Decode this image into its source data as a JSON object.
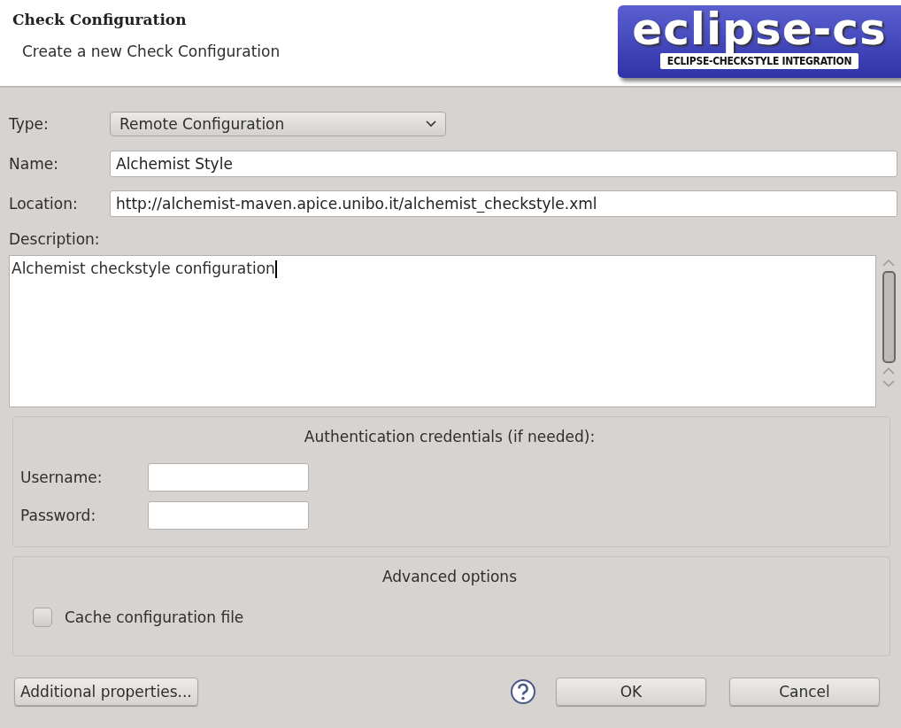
{
  "header": {
    "title": "Check Configuration",
    "subtitle": "Create a new Check Configuration",
    "logo": {
      "title": "eclipse-cs",
      "subtitle": "ECLIPSE-CHECKSTYLE INTEGRATION"
    }
  },
  "form": {
    "type": {
      "label": "Type:",
      "value": "Remote Configuration"
    },
    "name": {
      "label": "Name:",
      "value": "Alchemist Style"
    },
    "location": {
      "label": "Location:",
      "value": "http://alchemist-maven.apice.unibo.it/alchemist_checkstyle.xml"
    },
    "description": {
      "label": "Description:",
      "value": "Alchemist checkstyle configuration"
    }
  },
  "authentication": {
    "title": "Authentication credentials (if needed):",
    "username": {
      "label": "Username:"
    },
    "password": {
      "label": "Password:"
    }
  },
  "advanced": {
    "title": "Advanced options",
    "cache": {
      "label": "Cache configuration file",
      "checked": false
    }
  },
  "buttons": {
    "additional": "Additional properties...",
    "ok": "OK",
    "cancel": "Cancel"
  }
}
